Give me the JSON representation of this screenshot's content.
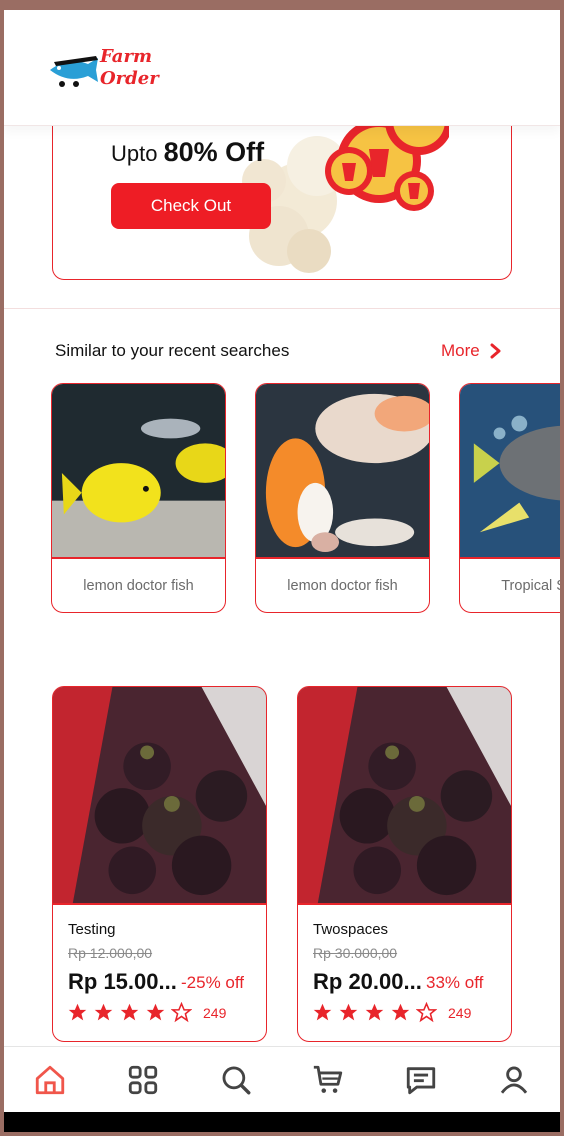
{
  "app": {
    "logo_text_line1": "Farm",
    "logo_text_line2": "Order",
    "logo_icon": "fish-cart-logo"
  },
  "banner": {
    "promo_prefix": "Upto",
    "promo_highlight": "80% Off",
    "button_label": "Check Out",
    "decoration": "popcorn-image"
  },
  "similar": {
    "title": "Similar to your recent searches",
    "more_label": "More",
    "items": [
      {
        "label": "lemon doctor fish",
        "image": "yellow-tang-fish-photo"
      },
      {
        "label": "lemon doctor fish",
        "image": "koi-fish-photo"
      },
      {
        "label": "Tropical Saltw",
        "image": "angelfish-photo"
      }
    ]
  },
  "products": [
    {
      "name": "Testing",
      "old_price": "Rp 12.000,00",
      "price": "Rp 15.00...",
      "discount": "-25% off",
      "rating": 4,
      "reviews": "249",
      "image": "mangosteen-photo"
    },
    {
      "name": "Twospaces",
      "old_price": "Rp 30.000,00",
      "price": "Rp 20.00...",
      "discount": "33% off",
      "rating": 4,
      "reviews": "249",
      "image": "mangosteen-photo"
    }
  ],
  "nav": [
    "home-icon",
    "grid-icon",
    "search-icon",
    "cart-icon",
    "chat-icon",
    "profile-icon"
  ],
  "colors": {
    "accent": "#e8252b",
    "button": "#ee1d25",
    "text": "#111111",
    "muted": "#6b6b6b"
  }
}
